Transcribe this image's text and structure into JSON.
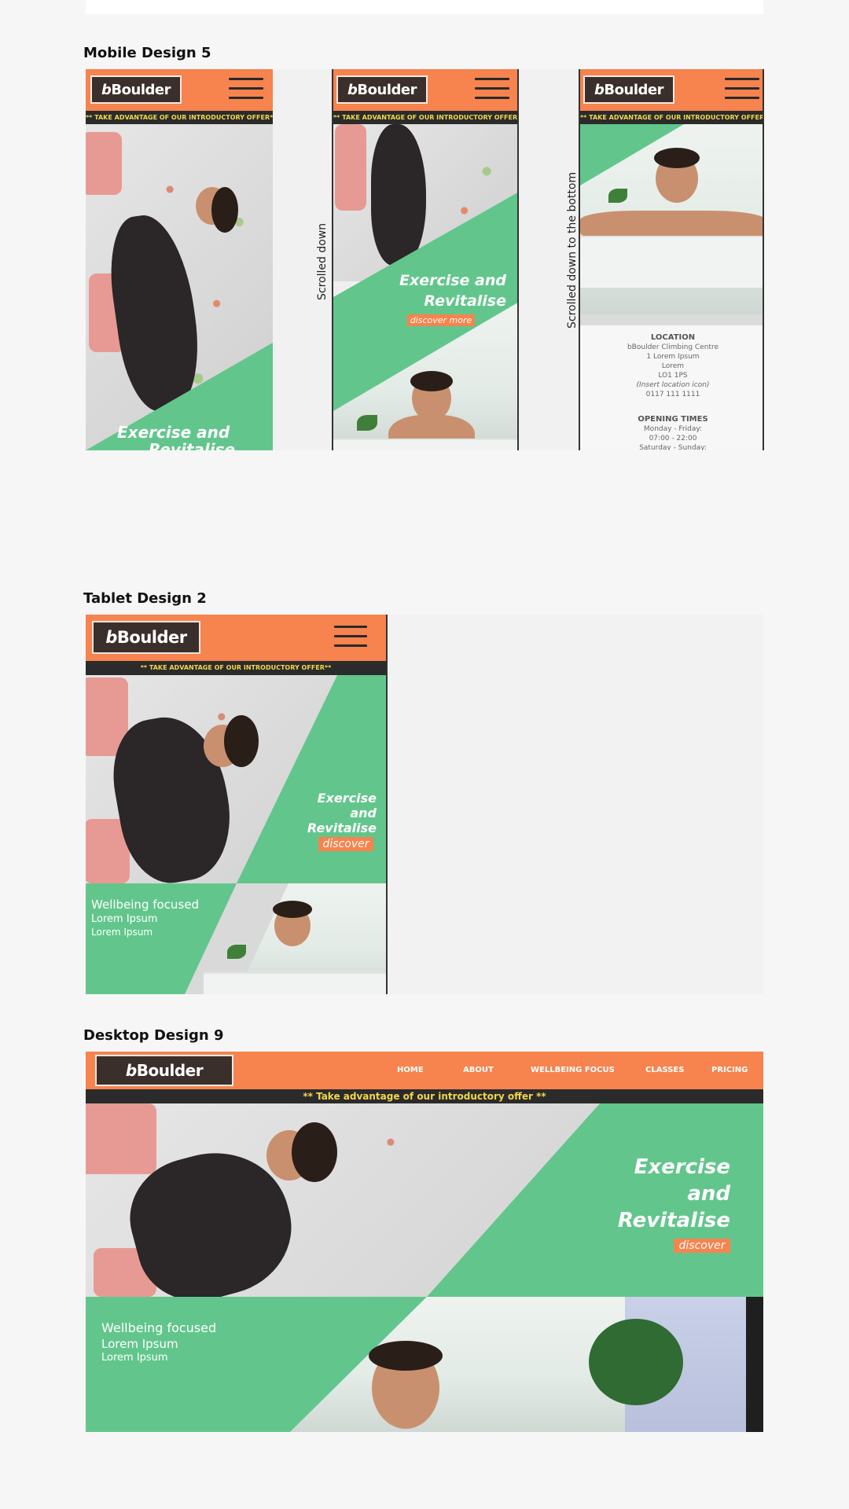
{
  "sections": {
    "mobile": "Mobile Design 5",
    "tablet": "Tablet Design 2",
    "desktop": "Desktop Design 9"
  },
  "brand": {
    "logo_prefix": "b",
    "logo_name": "Boulder",
    "orange": "#f7834e",
    "green": "#62c68c",
    "dark": "#2b2b2b",
    "offer_yellow": "#f2d64b"
  },
  "offer_upper": "** TAKE ADVANTAGE OF OUR INTRODUCTORY OFFER**",
  "offer_desktop": "**  Take advantage of our introductory offer  **",
  "hero": {
    "line_a": "Exercise and",
    "line_b": "Revitalise",
    "l1": "Exercise",
    "l2": "and",
    "l3": "Revitalise",
    "cta_more": "discover more",
    "cta": "discover",
    "cut_text": "Revitalise"
  },
  "labels": {
    "scrolled_down": "Scrolled down",
    "scrolled_bottom": "Scrolled down to the bottom"
  },
  "info": {
    "location_title": "LOCATION",
    "location_lines": [
      "bBoulder Climbing Centre",
      "1 Lorem Ipsum",
      "Lorem",
      "LO1 1PS",
      "(Insert location icon)",
      "0117 111 1111"
    ],
    "opening_title": "OPENING TIMES",
    "opening_lines": [
      "Monday - Friday:",
      "07:00 - 22:00",
      "Saturday - Sunday:"
    ]
  },
  "wellbeing": {
    "title": "Wellbeing focused",
    "line1": "Lorem Ipsum",
    "line2": "Lorem Ipsum"
  },
  "nav": [
    "HOME",
    "ABOUT",
    "WELLBEING FOCUS",
    "CLASSES",
    "PRICING"
  ],
  "icons": [
    "hamburger-menu-icon"
  ]
}
